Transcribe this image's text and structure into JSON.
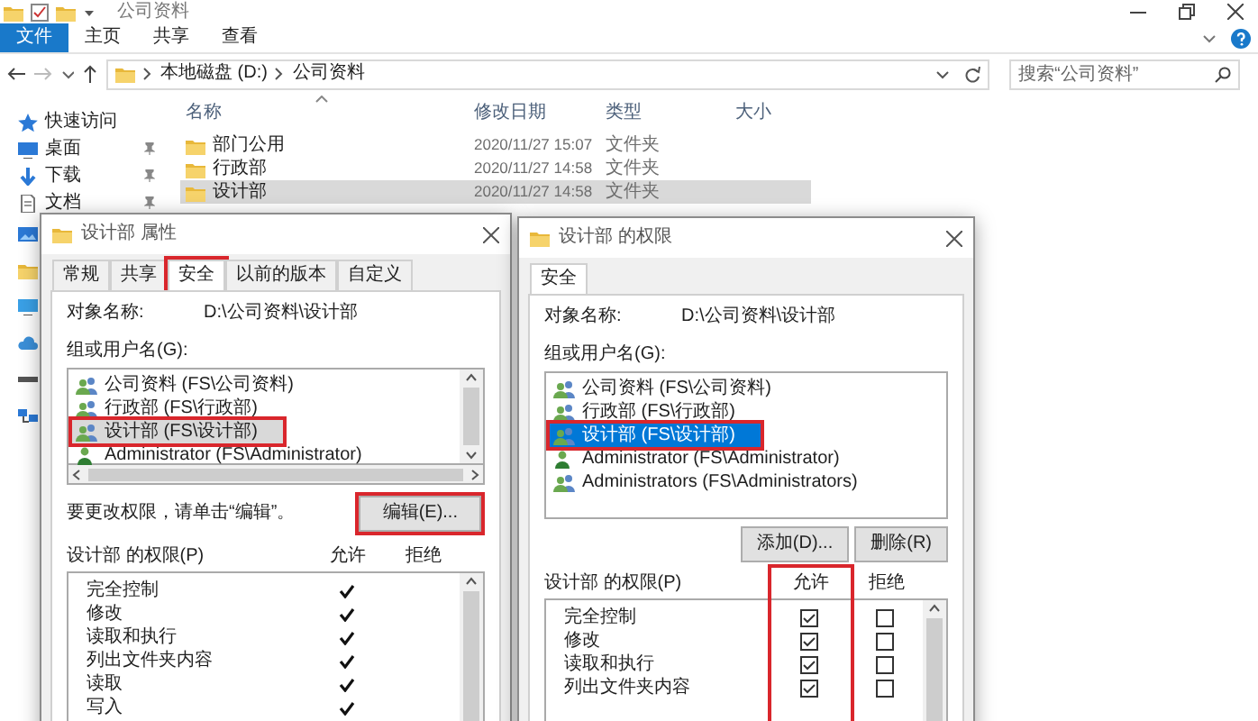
{
  "explorer": {
    "title": "公司资料",
    "ribbon_tabs": [
      {
        "label": "文件",
        "selected": true
      },
      {
        "label": "主页",
        "selected": false
      },
      {
        "label": "共享",
        "selected": false
      },
      {
        "label": "查看",
        "selected": false
      }
    ],
    "path": [
      "本地磁盘 (D:)",
      "公司资料"
    ],
    "search": {
      "placeholder": "搜索“公司资料”"
    },
    "nav": [
      {
        "label": "快速访问",
        "kind": "star",
        "pinned": false
      },
      {
        "label": "桌面",
        "kind": "desktop",
        "pinned": true
      },
      {
        "label": "下载",
        "kind": "download",
        "pinned": true
      },
      {
        "label": "文档",
        "kind": "document",
        "pinned": true
      },
      {
        "kind": "pictures"
      },
      {
        "kind": "folder"
      },
      {
        "kind": "pc"
      },
      {
        "kind": "cloud"
      },
      {
        "kind": "drive"
      },
      {
        "kind": "network"
      }
    ],
    "columns": [
      "名称",
      "修改日期",
      "类型",
      "大小"
    ],
    "files": [
      {
        "name": "部门公用",
        "modified": "2020/11/27 15:07",
        "type": "文件夹",
        "selected": false
      },
      {
        "name": "行政部",
        "modified": "2020/11/27 14:58",
        "type": "文件夹",
        "selected": false
      },
      {
        "name": "设计部",
        "modified": "2020/11/27 14:58",
        "type": "文件夹",
        "selected": true
      }
    ]
  },
  "properties_dialog": {
    "title": "设计部 属性",
    "tabs": [
      {
        "label": "常规",
        "selected": false,
        "highlighted": false
      },
      {
        "label": "共享",
        "selected": false,
        "highlighted": false
      },
      {
        "label": "安全",
        "selected": true,
        "highlighted": true
      },
      {
        "label": "以前的版本",
        "selected": false,
        "highlighted": false
      },
      {
        "label": "自定义",
        "selected": false,
        "highlighted": false
      }
    ],
    "object_label": "对象名称:",
    "object_value": "D:\\公司资料\\设计部",
    "group_label": "组或用户名(G):",
    "list_focused": false,
    "users": [
      {
        "name": "公司资料 (FS\\公司资料)",
        "kind": "group",
        "selected": false,
        "highlighted": false
      },
      {
        "name": "行政部 (FS\\行政部)",
        "kind": "group",
        "selected": false,
        "highlighted": false
      },
      {
        "name": "设计部 (FS\\设计部)",
        "kind": "group",
        "selected": true,
        "highlighted": true
      },
      {
        "name": "Administrator (FS\\Administrator)",
        "kind": "user",
        "selected": false,
        "highlighted": false
      }
    ],
    "hint": "要更改权限，请单击“编辑”。",
    "buttons": [
      {
        "label": "编辑(E)...",
        "highlighted": true
      }
    ],
    "perm_title": "设计部 的权限(P)",
    "allow_header": "允许",
    "deny_header": "拒绝",
    "permissions": [
      {
        "name": "完全控制",
        "kind": "tick",
        "allow": true,
        "deny": false
      },
      {
        "name": "修改",
        "kind": "tick",
        "allow": true,
        "deny": false
      },
      {
        "name": "读取和执行",
        "kind": "tick",
        "allow": true,
        "deny": false
      },
      {
        "name": "列出文件夹内容",
        "kind": "tick",
        "allow": true,
        "deny": false
      },
      {
        "name": "读取",
        "kind": "tick",
        "allow": true,
        "deny": false
      },
      {
        "name": "写入",
        "kind": "tick",
        "allow": true,
        "deny": false
      }
    ]
  },
  "permissions_dialog": {
    "title": "设计部 的权限",
    "tabs": [
      {
        "label": "安全",
        "selected": true,
        "highlighted": false
      }
    ],
    "object_label": "对象名称:",
    "object_value": "D:\\公司资料\\设计部",
    "group_label": "组或用户名(G):",
    "list_focused": true,
    "users": [
      {
        "name": "公司资料 (FS\\公司资料)",
        "kind": "group",
        "selected": false,
        "highlighted": false
      },
      {
        "name": "行政部 (FS\\行政部)",
        "kind": "group",
        "selected": false,
        "highlighted": false
      },
      {
        "name": "设计部 (FS\\设计部)",
        "kind": "group",
        "selected": true,
        "highlighted": true
      },
      {
        "name": "Administrator (FS\\Administrator)",
        "kind": "user",
        "selected": false,
        "highlighted": false
      },
      {
        "name": "Administrators (FS\\Administrators)",
        "kind": "group",
        "selected": false,
        "highlighted": false
      }
    ],
    "buttons": [
      {
        "label": "添加(D)...",
        "highlighted": false
      },
      {
        "label": "删除(R)",
        "highlighted": false
      }
    ],
    "perm_title": "设计部 的权限(P)",
    "allow_header": "允许",
    "deny_header": "拒绝",
    "allow_column_highlighted": true,
    "permissions": [
      {
        "name": "完全控制",
        "kind": "checkbox",
        "allow": true,
        "deny": false
      },
      {
        "name": "修改",
        "kind": "checkbox",
        "allow": true,
        "deny": false
      },
      {
        "name": "读取和执行",
        "kind": "checkbox",
        "allow": true,
        "deny": false
      },
      {
        "name": "列出文件夹内容",
        "kind": "checkbox",
        "allow": true,
        "deny": false
      }
    ]
  }
}
